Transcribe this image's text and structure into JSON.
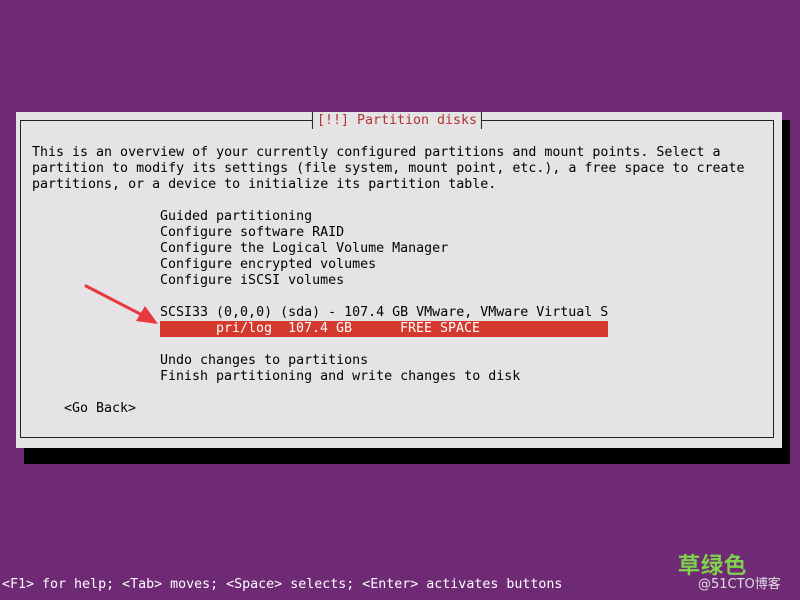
{
  "dialog": {
    "title": "[!!] Partition disks",
    "description_lines": [
      "This is an overview of your currently configured partitions and mount points. Select a",
      "partition to modify its settings (file system, mount point, etc.), a free space to create",
      "partitions, or a device to initialize its partition table."
    ]
  },
  "menu": {
    "guided_partitioning": "Guided partitioning",
    "configure_software_raid": "Configure software RAID",
    "configure_lvm": "Configure the Logical Volume Manager",
    "configure_encrypted": "Configure encrypted volumes",
    "configure_iscsi": "Configure iSCSI volumes",
    "disk": "SCSI33 (0,0,0) (sda) - 107.4 GB VMware, VMware Virtual S",
    "free_space": {
      "type": "pri/log",
      "size": "107.4 GB",
      "label": "FREE SPACE"
    },
    "undo_changes": "Undo changes to partitions",
    "finish_partitioning": "Finish partitioning and write changes to disk"
  },
  "go_back": "<Go Back>",
  "help_bar": "<F1> for help; <Tab> moves; <Space> selects; <Enter> activates buttons",
  "watermark": {
    "text": "草绿色",
    "site": "@51CTO博客"
  },
  "colors": {
    "background": "#6f2a76",
    "dialog": "#e6e3e6",
    "selection": "#d5382d",
    "title_accent": "#b0342d",
    "arrow": "#e8383d"
  }
}
